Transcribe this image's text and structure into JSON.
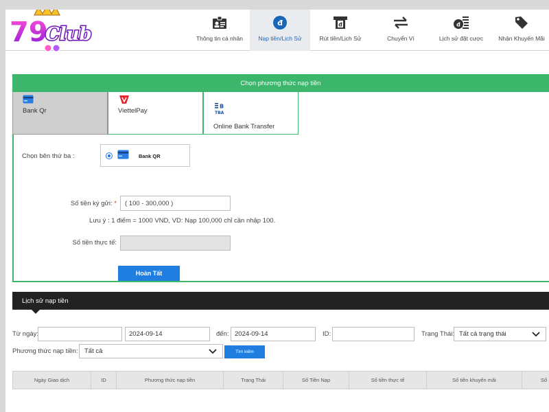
{
  "brand": {
    "logo_text": "79Club"
  },
  "nav": {
    "items": [
      {
        "label": "Thông tin cá nhân",
        "icon": "id-card-icon"
      },
      {
        "label": "Nạp tiền/Lịch Sử",
        "icon": "coin-icon",
        "active": true
      },
      {
        "label": "Rút tiền/Lịch Sử",
        "icon": "atm-withdraw-icon"
      },
      {
        "label": "Chuyển Ví",
        "icon": "transfer-arrows-icon"
      },
      {
        "label": "Lịch sử đặt cược",
        "icon": "coin-stack-list-icon"
      },
      {
        "label": "Nhận Khuyến Mãi",
        "icon": "tag-icon"
      }
    ]
  },
  "deposit": {
    "title": "Chọn phương thức nạp tiền",
    "methods": [
      {
        "label": "Bank Qr",
        "icon": "bank-card-icon",
        "selected": true
      },
      {
        "label": "ViettelPay",
        "icon": "viettelpay-icon",
        "selected": false
      },
      {
        "label": "Online Bank Transfer",
        "icon": "online-bank-icon",
        "selected": false
      }
    ],
    "third_party_label": "Chọn bên thứ ba :",
    "third_party_option": "Bank QR",
    "amount_label": "Số tiền ký gửi:",
    "amount_required_mark": "*",
    "amount_placeholder": "( 100 - 300,000 )",
    "note": "Lưu ý : 1 điểm = 1000 VND, VD: Nạp 100,000 chỉ cần nhập 100.",
    "actual_label": "Số tiền thực tế:",
    "actual_value": "",
    "submit_label": "Hoàn Tất"
  },
  "history": {
    "title": "Lịch sử nạp tiền",
    "from_label": "Từ ngày:",
    "from_value": "",
    "from_date": "2024-09-14",
    "to_label": "đến:",
    "to_date": "2024-09-14",
    "id_label": "ID:",
    "id_value": "",
    "status_label": "Trạng Thái:",
    "status_value": "Tất cả trạng thái",
    "method_label": "Phương thức nạp tiền:",
    "method_value": "Tất cả",
    "search_label": "Tìm kiếm",
    "columns": [
      "Ngày Giao dịch",
      "ID",
      "Phương thức nạp tiền",
      "Trạng Thái",
      "Số Tiền Nạp",
      "Số tiền thực tế",
      "Số tiền khuyến mãi",
      "Số"
    ]
  },
  "colors": {
    "green": "#3cb66a",
    "blue": "#1f7ee0",
    "dark": "#222222"
  }
}
